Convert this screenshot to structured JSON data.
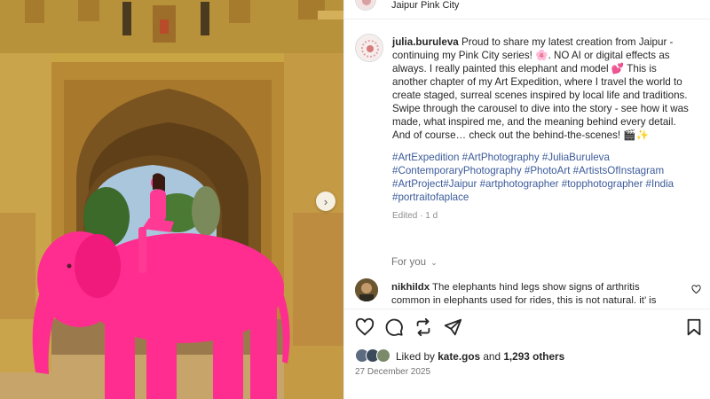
{
  "header": {
    "location": "Jaipur Pink City"
  },
  "caption": {
    "username": "julia.buruleva",
    "text": " Proud to share my latest creation from Jaipur - continuing my Pink City series! 🌸. NO AI or digital effects as always. I really painted this elephant and model 💕 This is another chapter of my Art Expedition, where I travel the world to create staged, surreal scenes inspired by local life and traditions. Swipe through the carousel to dive into the story - see how it was made, what inspired me, and the meaning behind every detail. And of course… check out the behind-the-scenes! 🎬✨",
    "hashtags": "#ArtExpedition #ArtPhotography #JuliaBuruleva #ContemporaryPhotography #PhotoArt #ArtistsOfInstagram #ArtProject#Jaipur #artphotographer #topphotographer #India #portraitofaplace",
    "edited": "Edited · 1 d"
  },
  "for_you": {
    "label": "For you",
    "icon": "chevron-down-icon"
  },
  "comment": {
    "username": "nikhildx",
    "text": " The elephants hind legs show signs of arthritis common in elephants used for rides, this is not natural. it’ is"
  },
  "actions": {
    "icons": [
      "heart-icon",
      "comment-icon",
      "repost-icon",
      "share-icon",
      "save-icon"
    ]
  },
  "likes": {
    "prefix": "Liked by ",
    "liker": "kate.gos",
    "middle": " and ",
    "others": "1,293 others"
  },
  "date": "27 December 2025",
  "colors": {
    "hashtag": "#3b5a9a",
    "elephant_pink": "#ff2d8f",
    "wall_yellow": "#c9a544"
  }
}
